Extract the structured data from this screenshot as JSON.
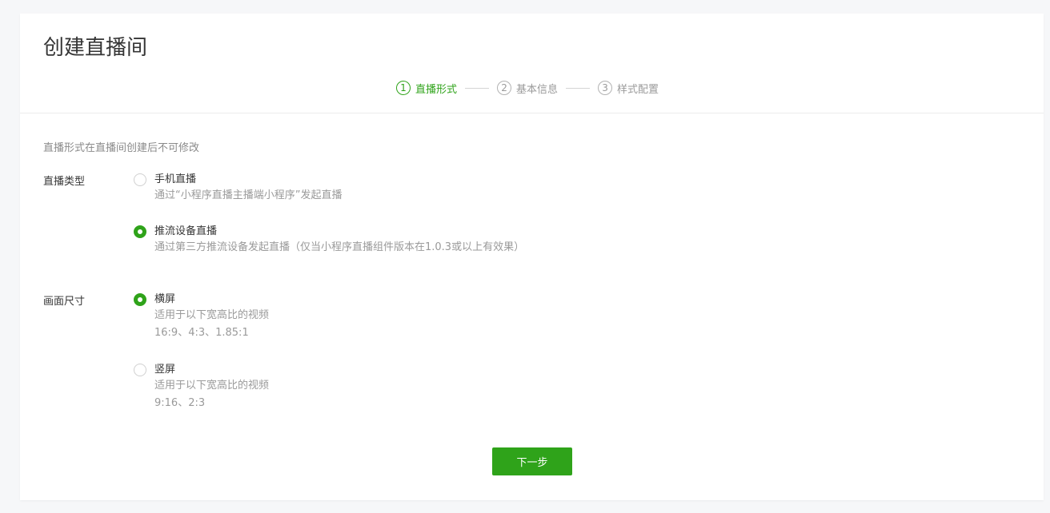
{
  "page_title": "创建直播间",
  "steps": [
    {
      "num": "1",
      "label": "直播形式",
      "active": true
    },
    {
      "num": "2",
      "label": "基本信息",
      "active": false
    },
    {
      "num": "3",
      "label": "样式配置",
      "active": false
    }
  ],
  "tip": "直播形式在直播间创建后不可修改",
  "live_type": {
    "label": "直播类型",
    "options": [
      {
        "title": "手机直播",
        "desc": "通过“小程序直播主播端小程序”发起直播",
        "checked": false
      },
      {
        "title": "推流设备直播",
        "desc": "通过第三方推流设备发起直播（仅当小程序直播组件版本在1.0.3或以上有效果）",
        "checked": true
      }
    ]
  },
  "screen_size": {
    "label": "画面尺寸",
    "options": [
      {
        "title": "横屏",
        "desc": "适用于以下宽高比的视频",
        "ratios": "16:9、4:3、1.85:1",
        "checked": true
      },
      {
        "title": "竖屏",
        "desc": "适用于以下宽高比的视频",
        "ratios": "9:16、2:3",
        "checked": false
      }
    ]
  },
  "next_button": "下一步",
  "colors": {
    "accent": "#2fa31a",
    "text": "#353535",
    "muted": "#9a9a9a",
    "background": "#f6f7f9"
  }
}
